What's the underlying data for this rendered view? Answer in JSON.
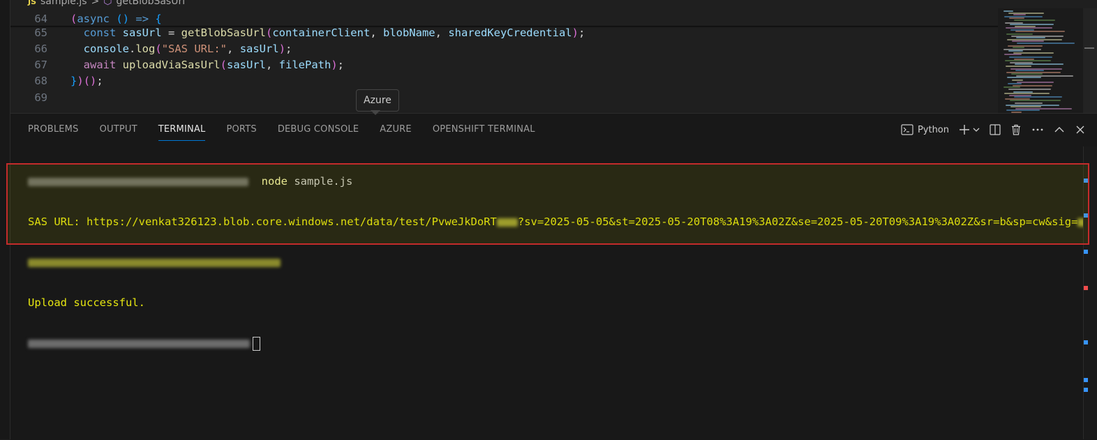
{
  "editor": {
    "breadcrumb": {
      "file_badge": "JS",
      "file": "sample.js",
      "separator": ">",
      "symbol": "getBlobSasUrl"
    },
    "lines": [
      {
        "n": "64",
        "tokens": [
          {
            "t": "(",
            "c": "br1"
          },
          {
            "t": "async",
            "c": "kw2"
          },
          {
            "t": " ",
            "c": "pun"
          },
          {
            "t": "()",
            "c": "br2"
          },
          {
            "t": " ",
            "c": "pun"
          },
          {
            "t": "=>",
            "c": "kw2"
          },
          {
            "t": " ",
            "c": "pun"
          },
          {
            "t": "{",
            "c": "br2"
          }
        ]
      },
      {
        "n": "65",
        "tokens": [
          {
            "t": "  const ",
            "c": "kw2"
          },
          {
            "t": "sasUrl",
            "c": "var"
          },
          {
            "t": " = ",
            "c": "pun"
          },
          {
            "t": "getBlobSasUrl",
            "c": "fn"
          },
          {
            "t": "(",
            "c": "br1"
          },
          {
            "t": "containerClient",
            "c": "var"
          },
          {
            "t": ", ",
            "c": "pun"
          },
          {
            "t": "blobName",
            "c": "var"
          },
          {
            "t": ", ",
            "c": "pun"
          },
          {
            "t": "sharedKeyCredential",
            "c": "var"
          },
          {
            "t": ")",
            "c": "br1"
          },
          {
            "t": ";",
            "c": "pun"
          }
        ]
      },
      {
        "n": "66",
        "tokens": [
          {
            "t": "  console",
            "c": "var"
          },
          {
            "t": ".",
            "c": "pun"
          },
          {
            "t": "log",
            "c": "fn"
          },
          {
            "t": "(",
            "c": "br1"
          },
          {
            "t": "\"SAS URL:\"",
            "c": "str"
          },
          {
            "t": ", ",
            "c": "pun"
          },
          {
            "t": "sasUrl",
            "c": "var"
          },
          {
            "t": ")",
            "c": "br1"
          },
          {
            "t": ";",
            "c": "pun"
          }
        ]
      },
      {
        "n": "67",
        "tokens": [
          {
            "t": "  await ",
            "c": "kw"
          },
          {
            "t": "uploadViaSasUrl",
            "c": "fn"
          },
          {
            "t": "(",
            "c": "br1"
          },
          {
            "t": "sasUrl",
            "c": "var"
          },
          {
            "t": ", ",
            "c": "pun"
          },
          {
            "t": "filePath",
            "c": "var"
          },
          {
            "t": ")",
            "c": "br1"
          },
          {
            "t": ";",
            "c": "pun"
          }
        ]
      },
      {
        "n": "68",
        "tokens": [
          {
            "t": "}",
            "c": "br2"
          },
          {
            "t": ")",
            "c": "br1"
          },
          {
            "t": "()",
            "c": "br1"
          },
          {
            "t": ";",
            "c": "pun"
          }
        ]
      },
      {
        "n": "69",
        "tokens": []
      }
    ]
  },
  "tooltip": {
    "text": "Azure"
  },
  "panel": {
    "tabs": [
      {
        "label": "PROBLEMS",
        "active": false
      },
      {
        "label": "OUTPUT",
        "active": false
      },
      {
        "label": "TERMINAL",
        "active": true
      },
      {
        "label": "PORTS",
        "active": false
      },
      {
        "label": "DEBUG CONSOLE",
        "active": false
      },
      {
        "label": "AZURE",
        "active": false
      },
      {
        "label": "OPENSHIFT TERMINAL",
        "active": false
      }
    ],
    "terminal_kind": "Python",
    "actions": [
      "terminal-icon",
      "add-terminal-icon",
      "chevron-down-icon",
      "split-terminal-icon",
      "trash-icon",
      "more-actions-icon",
      "maximize-panel-icon",
      "close-panel-icon"
    ]
  },
  "terminal": {
    "command": {
      "keyword": "node",
      "args": " sample.js"
    },
    "sas_prefix": "SAS URL: https://venkat326123.blob.core.windows.net/data/test/PvweJkDoRT",
    "sas_query": "?sv=2025-05-05&st=2025-05-20T08%3A19%3A02Z&se=2025-05-20T09%3A19%3A02Z&sr=b&sp=cw&sig=",
    "upload_message": "Upload successful."
  },
  "colors": {
    "accent": "#0078d4",
    "highlight_border": "#c42b2b",
    "terminal_yellow": "#e5e510"
  }
}
